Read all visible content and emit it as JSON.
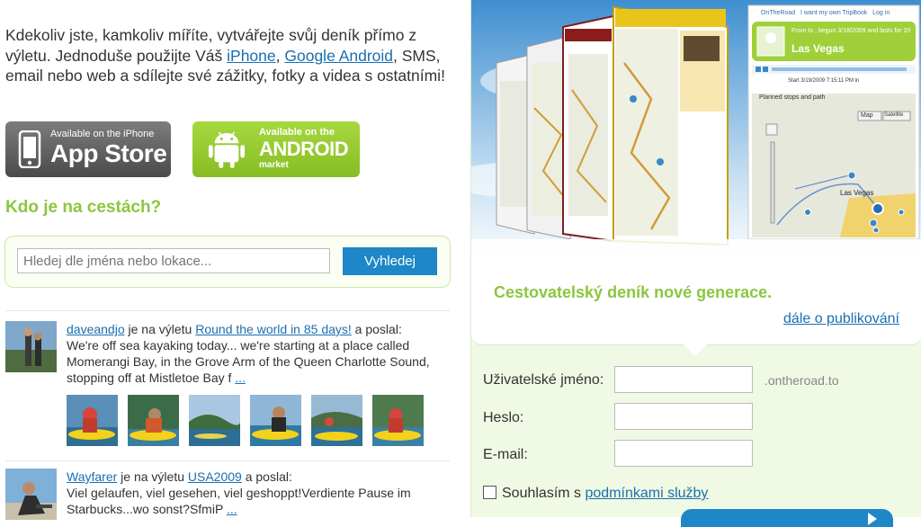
{
  "intro": {
    "part1": "Kdekoliv jste, kamkoliv míříte, vytvářejte svůj deník přímo z výletu. Jednoduše použijte Váš ",
    "link_iphone": "iPhone",
    "sep": ", ",
    "link_android": "Google Android",
    "part2": ", SMS, email nebo web a sdílejte své zážitky, fotky a videa s ostatními!"
  },
  "stores": {
    "apple": {
      "small": "Available on the iPhone",
      "big": "App Store"
    },
    "android": {
      "small": "Available on the",
      "big": "ANDROID",
      "tiny": "market"
    }
  },
  "who": {
    "heading": "Kdo je na cestách?"
  },
  "search": {
    "placeholder": "Hledej dle jména nebo lokace...",
    "button": "Vyhledej"
  },
  "posts": [
    {
      "user": "daveandjo",
      "is_on_trip": " je na výletu ",
      "trip": "Round the world in 85 days!",
      "posted": " a poslal:",
      "message": "We're off sea kayaking today... we're starting at a place called Momerangi Bay, in the Grove Arm of the Queen Charlotte Sound, stopping off at Mistletoe Bay f ",
      "more": "..."
    },
    {
      "user": "Wayfarer",
      "is_on_trip": " je na výletu ",
      "trip": "USA2009",
      "posted": " a poslal:",
      "message": "Viel gelaufen, viel gesehen, viel geshoppt!Verdiente Pause im Starbucks...wo sonst?SfmiP ",
      "more": "..."
    }
  ],
  "hero": {
    "nav1": "OnTheRoad",
    "nav2": "I want my own TripBook",
    "nav3": "Log in",
    "trip_info": "From to , begun 3/18/2009 and lasts for 20",
    "city": "Las Vegas",
    "start": "Start 3/19/2009 7:15:11 PM in",
    "planned": "Planned stops and path",
    "map_btn": "Map",
    "sat_btn": "Satellite",
    "map_city": "Las Vegas"
  },
  "tagline": "Cestovatelský deník nové generace.",
  "more_link": "dále o publikování",
  "form": {
    "username_label": "Uživatelské jméno:",
    "suffix": ".ontheroad.to",
    "password_label": "Heslo:",
    "email_label": "E-mail:",
    "terms_prefix": "Souhlasím s ",
    "terms_link": "podmínkami služby"
  },
  "colors": {
    "accent_green": "#8cc63f",
    "button_blue": "#1d87c8",
    "link_blue": "#1a6fb0"
  }
}
